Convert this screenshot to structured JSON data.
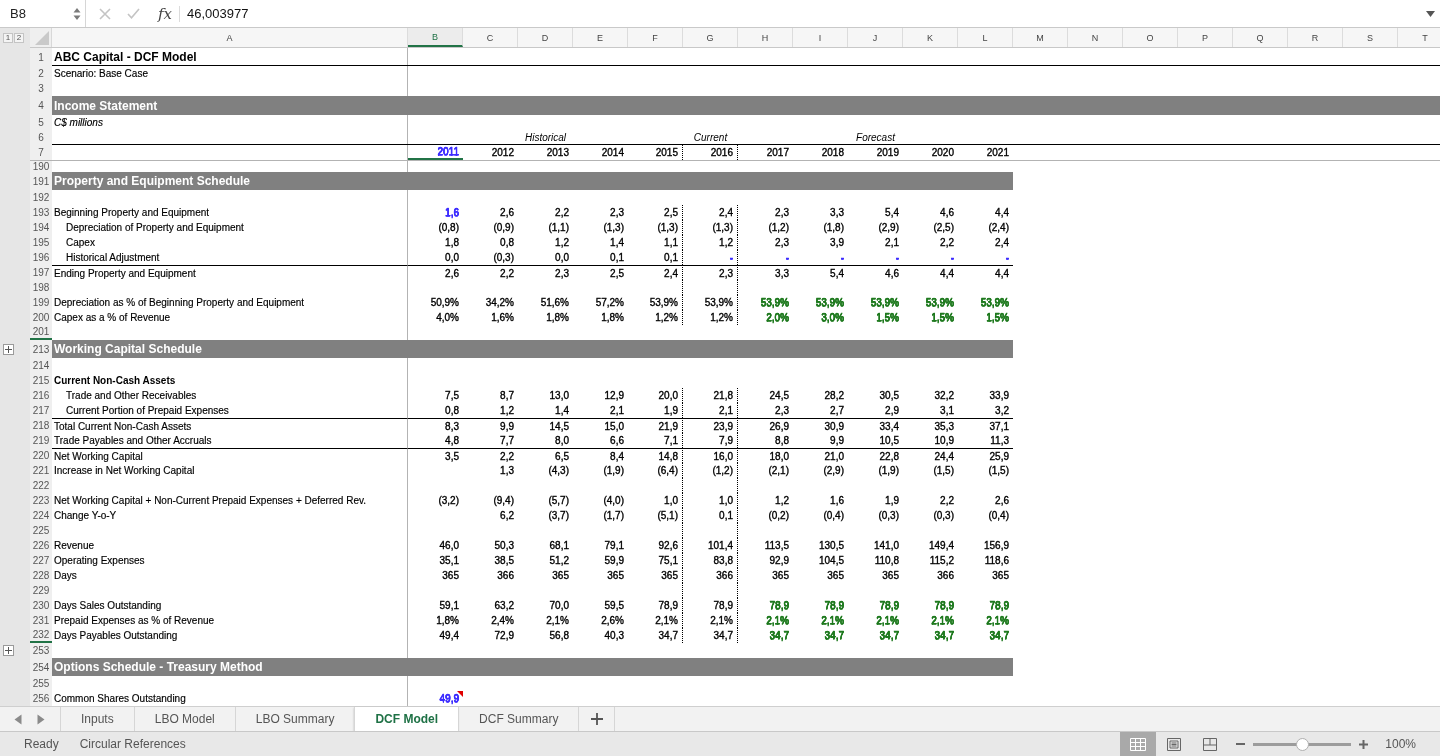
{
  "formula_bar": {
    "name_box": "B8",
    "function_label": "fx",
    "formula": "46,003977",
    "edit_buttons_disabled": true
  },
  "outline_levels": [
    "1",
    "2"
  ],
  "columns": [
    {
      "letter": "A",
      "selected": false
    },
    {
      "letter": "B",
      "selected": true
    },
    {
      "letter": "C",
      "selected": false
    },
    {
      "letter": "D",
      "selected": false
    },
    {
      "letter": "E",
      "selected": false
    },
    {
      "letter": "F",
      "selected": false
    },
    {
      "letter": "G",
      "selected": false
    },
    {
      "letter": "H",
      "selected": false
    },
    {
      "letter": "I",
      "selected": false
    },
    {
      "letter": "J",
      "selected": false
    },
    {
      "letter": "K",
      "selected": false
    },
    {
      "letter": "L",
      "selected": false
    },
    {
      "letter": "M",
      "selected": false
    },
    {
      "letter": "N",
      "selected": false
    },
    {
      "letter": "O",
      "selected": false
    },
    {
      "letter": "P",
      "selected": false
    },
    {
      "letter": "Q",
      "selected": false
    },
    {
      "letter": "R",
      "selected": false
    },
    {
      "letter": "S",
      "selected": false
    },
    {
      "letter": "T",
      "selected": false
    }
  ],
  "periods": [
    {
      "label": "Historical",
      "years": [
        {
          "text": "2011",
          "color": "#3d2dff"
        },
        "2012",
        "2013",
        "2014",
        "2015"
      ]
    },
    {
      "label": "Current",
      "years": [
        "2016"
      ]
    },
    {
      "label": "Forecast",
      "years": [
        "2017",
        "2018",
        "2019",
        "2020",
        "2021"
      ]
    }
  ],
  "frozen_rows": [
    {
      "number": "1",
      "kind": "title",
      "label": "ABC Capital - DCF Model"
    },
    {
      "number": "2",
      "kind": "text",
      "label": "Scenario: Base Case"
    },
    {
      "number": "3",
      "kind": "blank"
    },
    {
      "number": "4",
      "kind": "banner",
      "label": "Income Statement"
    },
    {
      "number": "5",
      "kind": "note",
      "label": "C$ millions"
    },
    {
      "number": "6",
      "kind": "periods"
    },
    {
      "number": "7",
      "kind": "years"
    }
  ],
  "rows": [
    {
      "number": "190",
      "kind": "blank"
    },
    {
      "number": "191",
      "kind": "section",
      "label": "Property and Equipment Schedule"
    },
    {
      "number": "192",
      "kind": "blank"
    },
    {
      "number": "193",
      "kind": "text",
      "label": "Beginning Property and Equipment",
      "values": [
        {
          "text": "1,6",
          "color": "#3d2dff"
        },
        "2,6",
        "2,2",
        "2,3",
        "2,5",
        "2,4",
        "2,3",
        "3,3",
        "5,4",
        "4,6",
        "4,4"
      ],
      "children": [
        {
          "number": "194",
          "kind": "text",
          "label": "Depreciation of Property and Equipment",
          "values": [
            "(0,8)",
            "(0,9)",
            "(1,1)",
            "(1,3)",
            "(1,3)",
            "(1,3)",
            "(1,2)",
            "(1,8)",
            "(2,9)",
            "(2,5)",
            "(2,4)"
          ]
        },
        {
          "number": "195",
          "kind": "text",
          "label": "Capex",
          "values": [
            "1,8",
            "0,8",
            "1,2",
            "1,4",
            "1,1",
            "1,2",
            "2,3",
            "3,9",
            "2,1",
            "2,2",
            "2,4"
          ]
        },
        {
          "number": "196",
          "kind": "text",
          "label": "Historical Adjustment",
          "values": [
            "0,0",
            "(0,3)",
            "0,0",
            "0,1",
            "0,1",
            {
              "text": "-",
              "color": "#3d2dff"
            },
            {
              "text": "-",
              "color": "#3d2dff"
            },
            {
              "text": "-",
              "color": "#3d2dff"
            },
            {
              "text": "-",
              "color": "#3d2dff"
            },
            {
              "text": "-",
              "color": "#3d2dff"
            },
            {
              "text": "-",
              "color": "#3d2dff"
            }
          ]
        }
      ]
    },
    {
      "number": "197",
      "kind": "total",
      "label": "Ending Property and Equipment",
      "values": [
        "2,6",
        "2,2",
        "2,3",
        "2,5",
        "2,4",
        "2,3",
        "3,3",
        "5,4",
        "4,6",
        "4,4",
        "4,4"
      ]
    },
    {
      "number": "198",
      "kind": "blank"
    },
    {
      "number": "199",
      "kind": "text",
      "label": "Depreciation as % of Beginning Property and Equipment",
      "values": [
        "50,9%",
        "34,2%",
        "51,6%",
        "57,2%",
        "53,9%",
        "53,9%",
        {
          "text": "53,9%",
          "color": "#1f7a1f"
        },
        {
          "text": "53,9%",
          "color": "#1f7a1f"
        },
        {
          "text": "53,9%",
          "color": "#1f7a1f"
        },
        {
          "text": "53,9%",
          "color": "#1f7a1f"
        },
        {
          "text": "53,9%",
          "color": "#1f7a1f"
        }
      ]
    },
    {
      "number": "200",
      "kind": "text",
      "label": "Capex as a % of Revenue",
      "values": [
        "4,0%",
        "1,6%",
        "1,8%",
        "1,8%",
        "1,2%",
        "1,2%",
        {
          "text": "2,0%",
          "color": "#1f7a1f"
        },
        {
          "text": "3,0%",
          "color": "#1f7a1f"
        },
        {
          "text": "1,5%",
          "color": "#1f7a1f"
        },
        {
          "text": "1,5%",
          "color": "#1f7a1f"
        },
        {
          "text": "1,5%",
          "color": "#1f7a1f"
        }
      ]
    },
    {
      "number": "201",
      "kind": "blank",
      "hidden_rows_below": true
    },
    {
      "number": "213",
      "kind": "section",
      "label": "Working Capital Schedule",
      "collapsed_group": true
    },
    {
      "number": "214",
      "kind": "blank"
    },
    {
      "number": "215",
      "kind": "subheading",
      "label": "Current Non-Cash Assets",
      "children": [
        {
          "number": "216",
          "kind": "text",
          "label": "Trade and Other Receivables",
          "values": [
            "7,5",
            "8,7",
            "13,0",
            "12,9",
            "20,0",
            "21,8",
            "24,5",
            "28,2",
            "30,5",
            "32,2",
            "33,9"
          ]
        },
        {
          "number": "217",
          "kind": "text",
          "label": "Current Portion of Prepaid Expenses",
          "values": [
            "0,8",
            "1,2",
            "1,4",
            "2,1",
            "1,9",
            "2,1",
            "2,3",
            "2,7",
            "2,9",
            "3,1",
            "3,2"
          ]
        }
      ]
    },
    {
      "number": "218",
      "kind": "total",
      "label": "Total Current Non-Cash Assets",
      "values": [
        "8,3",
        "9,9",
        "14,5",
        "15,0",
        "21,9",
        "23,9",
        "26,9",
        "30,9",
        "33,4",
        "35,3",
        "37,1"
      ]
    },
    {
      "number": "219",
      "kind": "text",
      "label": "Trade Payables and Other Accruals",
      "values": [
        "4,8",
        "7,7",
        "8,0",
        "6,6",
        "7,1",
        "7,9",
        "8,8",
        "9,9",
        "10,5",
        "10,9",
        "11,3"
      ]
    },
    {
      "number": "220",
      "kind": "total",
      "label": "Net Working Capital",
      "values": [
        "3,5",
        "2,2",
        "6,5",
        "8,4",
        "14,8",
        "16,0",
        "18,0",
        "21,0",
        "22,8",
        "24,4",
        "25,9"
      ]
    },
    {
      "number": "221",
      "kind": "text",
      "label": "Increase in Net Working Capital",
      "values": [
        "1,3",
        "(4,3)",
        "(1,9)",
        "(6,4)",
        "(1,2)",
        "(2,1)",
        "(2,9)",
        "(1,9)",
        "(1,5)",
        "(1,5)"
      ]
    },
    {
      "number": "222",
      "kind": "blank"
    },
    {
      "number": "223",
      "kind": "text",
      "label": "Net Working Capital + Non-Current Prepaid Expenses + Deferred Rev.",
      "values": [
        "(3,2)",
        "(9,4)",
        "(5,7)",
        "(4,0)",
        "1,0",
        "1,0",
        "1,2",
        "1,6",
        "1,9",
        "2,2",
        "2,6"
      ]
    },
    {
      "number": "224",
      "kind": "text",
      "label": "Change Y-o-Y",
      "values": [
        "6,2",
        "(3,7)",
        "(1,7)",
        "(5,1)",
        "0,1",
        "(0,2)",
        "(0,4)",
        "(0,3)",
        "(0,3)",
        "(0,4)"
      ]
    },
    {
      "number": "225",
      "kind": "blank"
    },
    {
      "number": "226",
      "kind": "text",
      "label": "Revenue",
      "values": [
        "46,0",
        "50,3",
        "68,1",
        "79,1",
        "92,6",
        "101,4",
        "113,5",
        "130,5",
        "141,0",
        "149,4",
        "156,9"
      ]
    },
    {
      "number": "227",
      "kind": "text",
      "label": "Operating Expenses",
      "values": [
        "35,1",
        "38,5",
        "51,2",
        "59,9",
        "75,1",
        "83,8",
        "92,9",
        "104,5",
        "110,8",
        "115,2",
        "118,6"
      ]
    },
    {
      "number": "228",
      "kind": "text",
      "label": "Days",
      "values": [
        "365",
        "366",
        "365",
        "365",
        "365",
        "366",
        "365",
        "365",
        "365",
        "366",
        "365"
      ]
    },
    {
      "number": "229",
      "kind": "blank"
    },
    {
      "number": "230",
      "kind": "text",
      "label": "Days Sales Outstanding",
      "values": [
        "59,1",
        "63,2",
        "70,0",
        "59,5",
        "78,9",
        "78,9",
        {
          "text": "78,9",
          "color": "#1f7a1f"
        },
        {
          "text": "78,9",
          "color": "#1f7a1f"
        },
        {
          "text": "78,9",
          "color": "#1f7a1f"
        },
        {
          "text": "78,9",
          "color": "#1f7a1f"
        },
        {
          "text": "78,9",
          "color": "#1f7a1f"
        }
      ]
    },
    {
      "number": "231",
      "kind": "text",
      "label": "Prepaid Expenses as % of Revenue",
      "values": [
        "1,8%",
        "2,4%",
        "2,1%",
        "2,6%",
        "2,1%",
        "2,1%",
        {
          "text": "2,1%",
          "color": "#1f7a1f"
        },
        {
          "text": "2,1%",
          "color": "#1f7a1f"
        },
        {
          "text": "2,1%",
          "color": "#1f7a1f"
        },
        {
          "text": "2,1%",
          "color": "#1f7a1f"
        },
        {
          "text": "2,1%",
          "color": "#1f7a1f"
        }
      ]
    },
    {
      "number": "232",
      "kind": "text",
      "label": "Days Payables Outstanding",
      "hidden_rows_below": true,
      "values": [
        "49,4",
        "72,9",
        "56,8",
        "40,3",
        "34,7",
        "34,7",
        {
          "text": "34,7",
          "color": "#1f7a1f"
        },
        {
          "text": "34,7",
          "color": "#1f7a1f"
        },
        {
          "text": "34,7",
          "color": "#1f7a1f"
        },
        {
          "text": "34,7",
          "color": "#1f7a1f"
        },
        {
          "text": "34,7",
          "color": "#1f7a1f"
        }
      ]
    },
    {
      "number": "253",
      "kind": "blank",
      "collapsed_group": true
    },
    {
      "number": "254",
      "kind": "section",
      "label": "Options Schedule - Treasury Method"
    },
    {
      "number": "255",
      "kind": "blank"
    },
    {
      "number": "256",
      "kind": "text",
      "label": "Common Shares Outstanding",
      "value": {
        "text": "49,9",
        "color": "#3d2dff",
        "comment": true
      }
    }
  ],
  "sheet_tabs": [
    {
      "label": "Inputs",
      "selected": false
    },
    {
      "label": "LBO Model",
      "selected": false
    },
    {
      "label": "LBO Summary",
      "selected": false
    },
    {
      "label": "DCF Model",
      "selected": true
    },
    {
      "label": "DCF Summary",
      "selected": false
    }
  ],
  "status_bar": {
    "items": [
      "Ready",
      "Circular References"
    ],
    "views": [
      {
        "kind": "normal",
        "selected": true
      },
      {
        "kind": "page_layout",
        "selected": false
      },
      {
        "kind": "page_break",
        "selected": false
      }
    ],
    "zoom": {
      "level": 0.5,
      "reading": "100%"
    }
  }
}
